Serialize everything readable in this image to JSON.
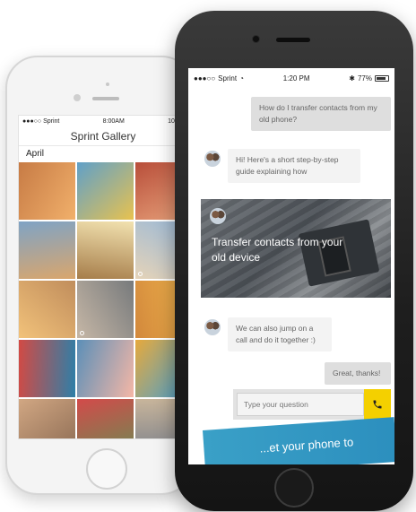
{
  "gallery_phone": {
    "status": {
      "signal": "●●●○○",
      "carrier": "Sprint",
      "time": "8:00AM",
      "battery": "100%"
    },
    "title": "Sprint Gallery",
    "month": "April",
    "photos": [
      {
        "name": "photo-bubbles-girl",
        "colors": [
          "#c77b45",
          "#f1b06b"
        ]
      },
      {
        "name": "photo-bulldog",
        "colors": [
          "#5fa0c9",
          "#e8c24f"
        ]
      },
      {
        "name": "photo-grandma",
        "colors": [
          "#b84e3a",
          "#e7a17a"
        ]
      },
      {
        "name": "photo-mountain-jump",
        "colors": [
          "#7fa3c5",
          "#d9a66d"
        ]
      },
      {
        "name": "photo-hikers",
        "colors": [
          "#f2e2b0",
          "#a67d4a"
        ]
      },
      {
        "name": "photo-beach-run",
        "colors": [
          "#9bb9d7",
          "#e5d3b8"
        ]
      },
      {
        "name": "photo-white-dog",
        "colors": [
          "#c08d5c",
          "#f2c27a"
        ]
      },
      {
        "name": "photo-father-son",
        "colors": [
          "#777a7c",
          "#c6b7a6"
        ]
      },
      {
        "name": "photo-sunset-field",
        "colors": [
          "#f0b44c",
          "#d2883c"
        ]
      },
      {
        "name": "photo-kayak",
        "colors": [
          "#2e7fa8",
          "#d24a44"
        ]
      },
      {
        "name": "photo-pool-party",
        "colors": [
          "#f5b7a6",
          "#5b8fb8"
        ]
      },
      {
        "name": "photo-smiling-woman",
        "colors": [
          "#46a0d3",
          "#e6a93c"
        ]
      },
      {
        "name": "photo-group-selfie",
        "colors": [
          "#8b6a52",
          "#d1a783"
        ]
      },
      {
        "name": "photo-watermelon",
        "colors": [
          "#6d8a52",
          "#d34a4a"
        ]
      },
      {
        "name": "photo-friends-laugh",
        "colors": [
          "#7a7f8a",
          "#c8b59b"
        ]
      }
    ]
  },
  "chat_phone": {
    "status": {
      "signal": "●●●○○",
      "carrier": "Sprint",
      "time": "1:20 PM",
      "battery": "77%"
    },
    "messages": {
      "user_1": "How do I transfer contacts from my old phone?",
      "agent_1": "Hi! Here's a short step-by-step guide explaining how",
      "card_title": "Transfer contacts from your old device",
      "agent_2": "We can also jump on a call and do it together :)",
      "user_2": "Great, thanks!"
    },
    "input": {
      "placeholder": "Type your question"
    },
    "banner_text": "...et your phone to"
  },
  "colors": {
    "accent_yellow": "#f4d000",
    "user_bubble": "#dedede",
    "agent_bubble": "#f3f3f3",
    "banner_blue": "#3aa0c7"
  }
}
